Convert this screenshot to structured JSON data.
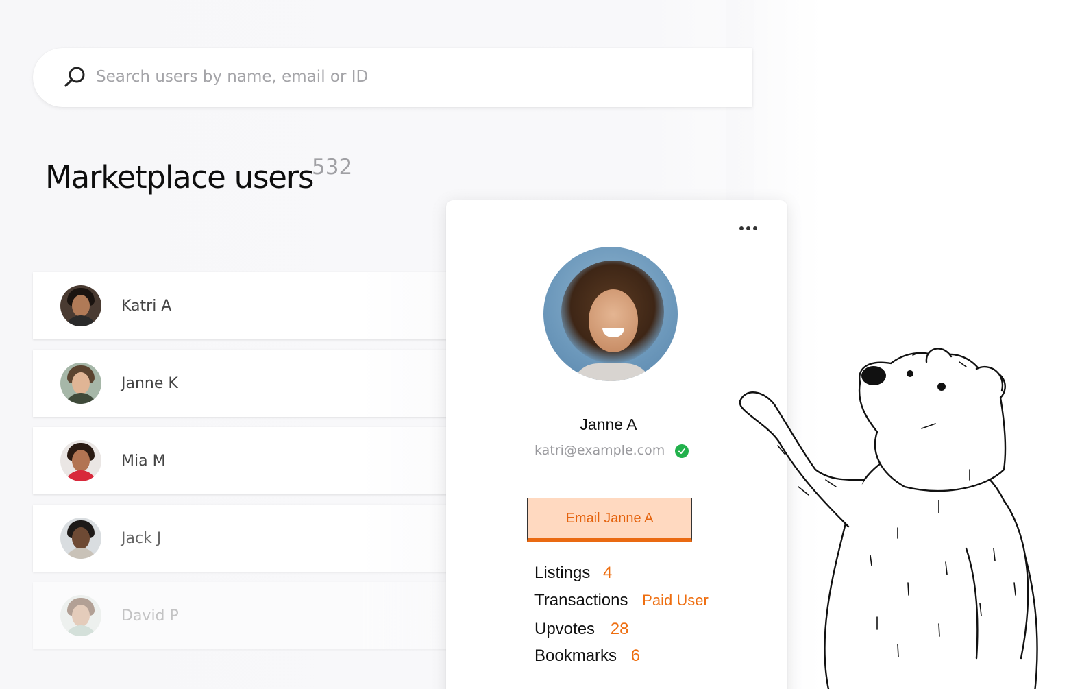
{
  "search": {
    "placeholder": "Search users by name, email or ID",
    "icon": "search-icon"
  },
  "page": {
    "title": "Marketplace users",
    "count": "532"
  },
  "users": [
    {
      "name": "Katri A"
    },
    {
      "name": "Janne K"
    },
    {
      "name": "Mia M"
    },
    {
      "name": "Jack J"
    },
    {
      "name": "David P"
    }
  ],
  "profile": {
    "name": "Janne A",
    "email": "katri@example.com",
    "email_button": "Email Janne A",
    "stats": [
      {
        "label": "Listings",
        "value": "4"
      },
      {
        "label": "Transactions",
        "value": "Paid User"
      },
      {
        "label": "Upvotes",
        "value": "28"
      },
      {
        "label": "Bookmarks",
        "value": "6"
      }
    ]
  },
  "colors": {
    "accent": "#ee6e10",
    "button_bg": "#ffd9c0",
    "verified": "#22b14c"
  }
}
